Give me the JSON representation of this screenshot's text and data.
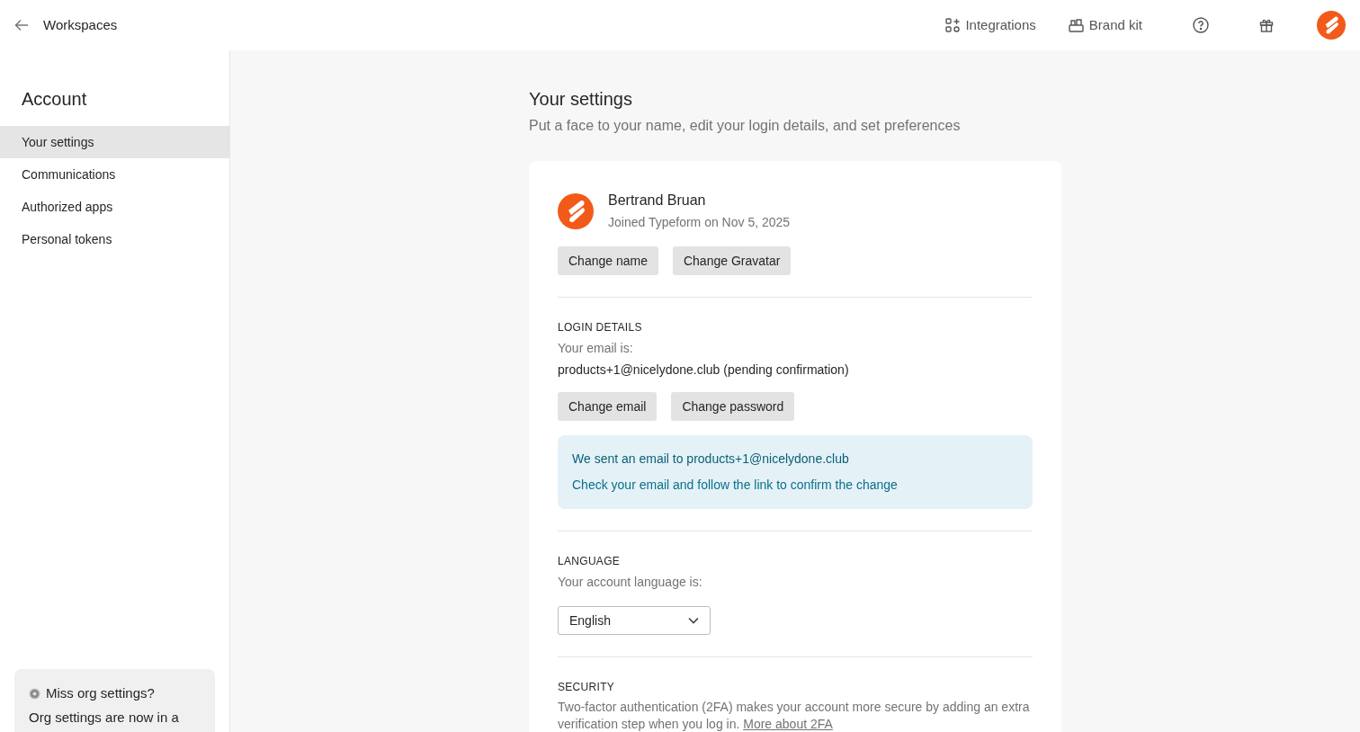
{
  "topbar": {
    "back_label": "Workspaces",
    "links": [
      {
        "kind": "integrations",
        "label": "Integrations"
      },
      {
        "kind": "brand",
        "label": "Brand kit"
      }
    ]
  },
  "sidebar": {
    "title": "Account",
    "items": [
      {
        "label": "Your settings",
        "selected": true
      },
      {
        "label": "Communications",
        "selected": false
      },
      {
        "label": "Authorized apps",
        "selected": false
      },
      {
        "label": "Personal tokens",
        "selected": false
      }
    ],
    "notice": {
      "title": "Miss org settings?",
      "body": "Org settings are now in a"
    }
  },
  "page": {
    "title": "Your settings",
    "subtitle": "Put a face to your name, edit your login details, and set preferences"
  },
  "profile": {
    "name": "Bertrand Bruan",
    "joined": "Joined Typeform on Nov 5, 2025",
    "buttons": [
      "Change name",
      "Change Gravatar"
    ]
  },
  "login": {
    "heading": "LOGIN DETAILS",
    "label": "Your email is:",
    "email": "products+1@nicelydone.club (pending confirmation)",
    "buttons": [
      "Change email",
      "Change password"
    ],
    "alert": {
      "title": "We sent an email to products+1@nicelydone.club",
      "body": "Check your email and follow the link to confirm the change"
    }
  },
  "language": {
    "heading": "LANGUAGE",
    "label": "Your account language is:",
    "value": "English"
  },
  "security": {
    "heading": "SECURITY",
    "text": "Two-factor authentication (2FA) makes your account more secure by adding an extra verification step when you log in.",
    "link": "More about 2FA"
  }
}
